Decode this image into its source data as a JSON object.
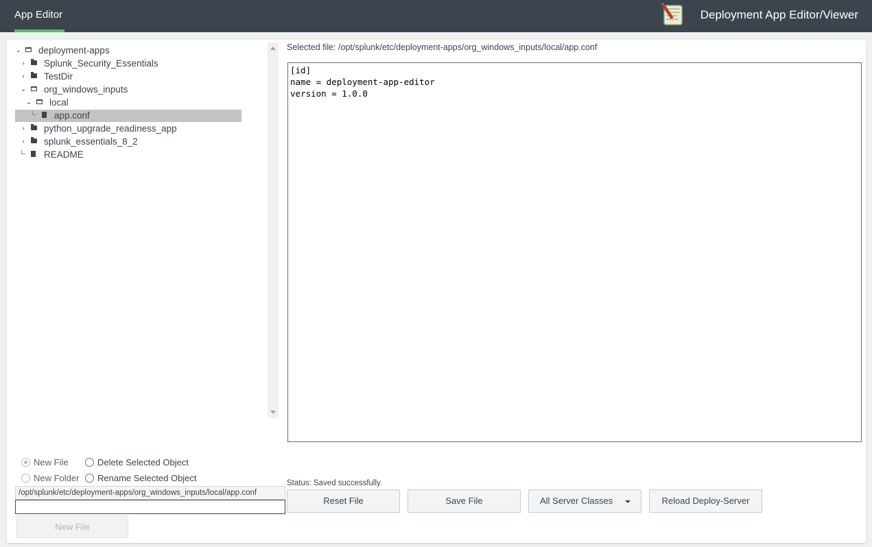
{
  "nav": {
    "tab_label": "App Editor"
  },
  "header": {
    "title": "Deployment App Editor/Viewer",
    "logo_icon": "notepad-pencil-icon"
  },
  "tree": {
    "items": [
      {
        "label": "deployment-apps",
        "type": "folder-open",
        "caret": "expanded",
        "depth": 0
      },
      {
        "label": "Splunk_Security_Essentials",
        "type": "folder",
        "caret": "collapsed",
        "depth": 1
      },
      {
        "label": "TestDir",
        "type": "folder",
        "caret": "collapsed",
        "depth": 1
      },
      {
        "label": "org_windows_inputs",
        "type": "folder-open",
        "caret": "expanded",
        "depth": 1
      },
      {
        "label": "local",
        "type": "folder-open",
        "caret": "expanded",
        "depth": 2
      },
      {
        "label": "app.conf",
        "type": "file",
        "caret": "leaf",
        "depth": 3,
        "selected": true
      },
      {
        "label": "python_upgrade_readiness_app",
        "type": "folder",
        "caret": "collapsed",
        "depth": 1
      },
      {
        "label": "splunk_essentials_8_2",
        "type": "folder",
        "caret": "collapsed",
        "depth": 1
      },
      {
        "label": "README",
        "type": "file",
        "caret": "leaf",
        "depth": 1
      }
    ]
  },
  "editor": {
    "selected_file_text": "Selected file: /opt/splunk/etc/deployment-apps/org_windows_inputs/local/app.conf",
    "lines": [
      "[id]",
      "name = deployment-app-editor",
      "version = 1.0.0"
    ]
  },
  "actions": {
    "new_file_label": "New File",
    "new_folder_label": "New Folder",
    "delete_label": "Delete Selected Object",
    "rename_label": "Rename Selected Object",
    "selected_action": "new_file",
    "path_value": "/opt/splunk/etc/deployment-apps/org_windows_inputs/local/app.conf",
    "name_input_value": "",
    "submit_button_label": "New File"
  },
  "status": {
    "text": "Status: Saved successfully."
  },
  "buttons": {
    "reset_label": "Reset File",
    "save_label": "Save File",
    "server_classes_label": "All Server Classes",
    "reload_label": "Reload Deploy-Server"
  },
  "colors": {
    "topbar": "#3c444d",
    "accent": "#5cc05c",
    "selected_row": "#c3c3c3"
  }
}
